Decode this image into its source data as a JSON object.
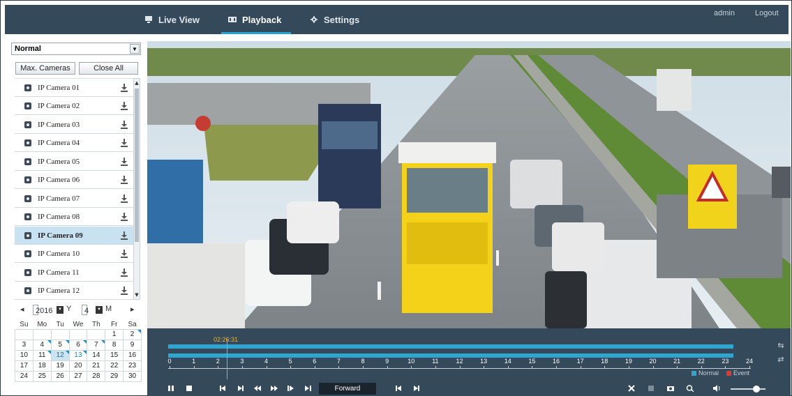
{
  "nav": {
    "tabs": [
      {
        "label": "Live View",
        "icon": "monitor-icon"
      },
      {
        "label": "Playback",
        "icon": "film-icon"
      },
      {
        "label": "Settings",
        "icon": "gear-icon"
      }
    ],
    "user": "admin",
    "logout": "Logout"
  },
  "sidebar": {
    "stream_select": "Normal",
    "max_cameras": "Max. Cameras",
    "close_all": "Close All",
    "cameras": [
      {
        "label": "IP Camera 01"
      },
      {
        "label": "IP Camera 02"
      },
      {
        "label": "IP Camera 03"
      },
      {
        "label": "IP Camera 04"
      },
      {
        "label": "IP Camera 05"
      },
      {
        "label": "IP Camera 06"
      },
      {
        "label": "IP Camera 07"
      },
      {
        "label": "IP Camera 08"
      },
      {
        "label": "IP Camera 09"
      },
      {
        "label": "IP Camera 10"
      },
      {
        "label": "IP Camera 11"
      },
      {
        "label": "IP Camera 12"
      }
    ],
    "selected_camera": "IP Camera 09"
  },
  "calendar": {
    "year": "2016",
    "year_unit": "Y",
    "month": "4",
    "month_unit": "M",
    "weekdays": [
      "Su",
      "Mo",
      "Tu",
      "We",
      "Th",
      "Fr",
      "Sa"
    ],
    "weeks": [
      [
        "",
        "",
        "",
        "",
        "",
        "1",
        "2"
      ],
      [
        "3",
        "4",
        "5",
        "6",
        "7",
        "8",
        "9"
      ],
      [
        "10",
        "11",
        "12",
        "13",
        "14",
        "15",
        "16"
      ],
      [
        "17",
        "18",
        "19",
        "20",
        "21",
        "22",
        "23"
      ],
      [
        "24",
        "25",
        "26",
        "27",
        "28",
        "29",
        "30"
      ]
    ],
    "recorded_days": [
      "2",
      "4",
      "5",
      "6",
      "7",
      "11",
      "12",
      "13"
    ],
    "selected_day": "12"
  },
  "timeline": {
    "current_time": "02:26:31",
    "hours": [
      "0",
      "1",
      "2",
      "3",
      "4",
      "5",
      "6",
      "7",
      "8",
      "9",
      "10",
      "11",
      "12",
      "13",
      "14",
      "15",
      "16",
      "17",
      "18",
      "19",
      "20",
      "21",
      "22",
      "23",
      "24"
    ],
    "legend_normal": "Normal",
    "legend_event": "Event",
    "normal_color": "#2fa5d0",
    "event_color": "#e03a2f"
  },
  "controls": {
    "direction": "Forward",
    "volume_level": 0.7
  },
  "colors": {
    "nav_bg": "#34495a",
    "accent": "#27a6d6",
    "cursor": "#d6a431"
  }
}
